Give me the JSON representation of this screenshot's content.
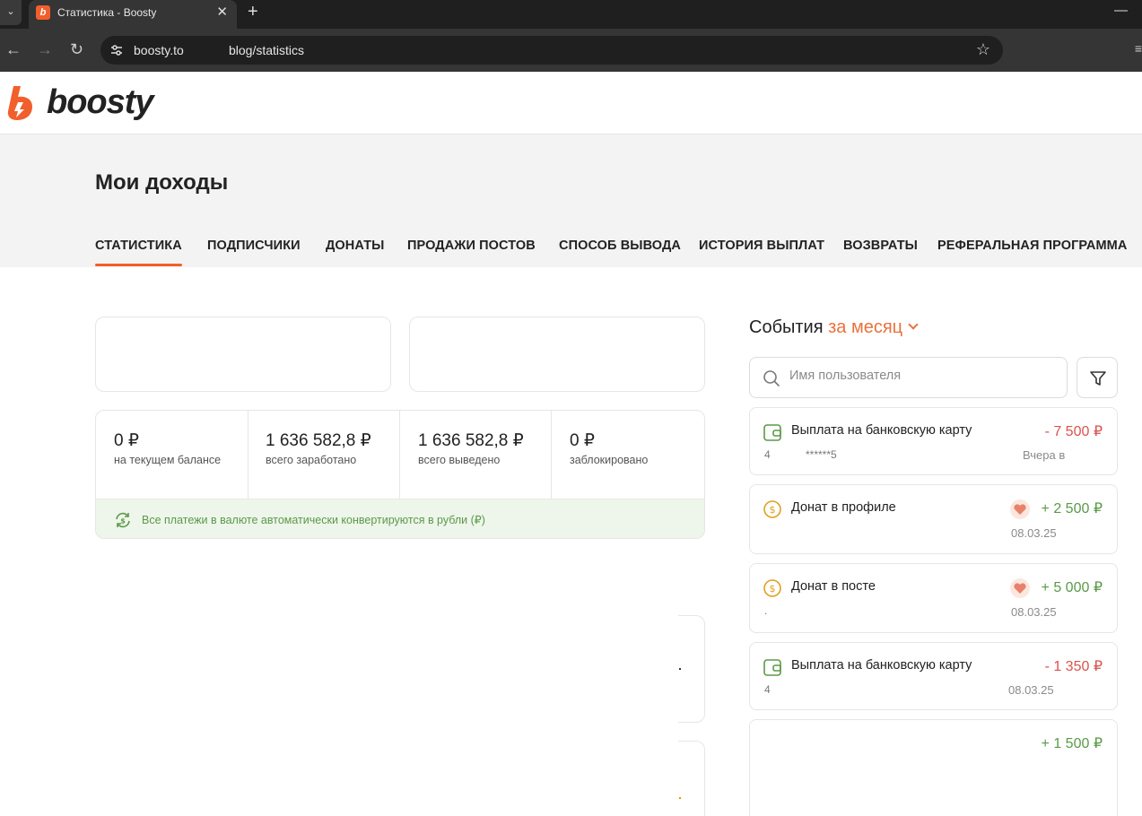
{
  "browser": {
    "tab_title": "Статистика - Boosty",
    "tab_close": "✕",
    "new_tab": "+",
    "url_host": "boosty.to",
    "url_path": "blog/statistics"
  },
  "site": {
    "logo_text": "boosty",
    "brand_color": "#f15f2c"
  },
  "page": {
    "title": "Мои доходы",
    "tabs": [
      {
        "label": "СТАТИСТИКА",
        "active": true
      },
      {
        "label": "ПОДПИСЧИКИ"
      },
      {
        "label": "ДОНАТЫ"
      },
      {
        "label": "ПРОДАЖИ ПОСТОВ"
      },
      {
        "label": "СПОСОБ ВЫВОДА"
      },
      {
        "label": "ИСТОРИЯ ВЫПЛАТ"
      },
      {
        "label": "ВОЗВРАТЫ"
      },
      {
        "label": "РЕФЕРАЛЬНАЯ ПРОГРАММА"
      }
    ]
  },
  "stats": [
    {
      "value": "0 ₽",
      "label": "на текущем балансе"
    },
    {
      "value": "1 636 582,8 ₽",
      "label": "всего заработано"
    },
    {
      "value": "1 636 582,8 ₽",
      "label": "всего выведено"
    },
    {
      "value": "0 ₽",
      "label": "заблокировано"
    }
  ],
  "notice": "Все платежи в валюте автоматически конвертируются в рубли (₽)",
  "events": {
    "title": "События",
    "period": "за месяц",
    "search_placeholder": "Имя пользователя",
    "items": [
      {
        "type": "payout",
        "title": "Выплата на банковскую карту",
        "amount": "- 7 500 ₽",
        "sub": "4",
        "sub2": "******5",
        "date": "Вчера в"
      },
      {
        "type": "donate",
        "title": "Донат в профиле",
        "amount": "+ 2 500 ₽",
        "date": "08.03.25"
      },
      {
        "type": "donate",
        "title": "Донат в посте",
        "amount": "+ 5 000 ₽",
        "sub": ".",
        "date": "08.03.25"
      },
      {
        "type": "payout",
        "title": "Выплата на банковскую карту",
        "amount": "- 1 350 ₽",
        "sub": "4",
        "date": "08.03.25"
      },
      {
        "type": "income",
        "title": "",
        "amount": "+ 1 500 ₽",
        "date": ""
      }
    ]
  }
}
